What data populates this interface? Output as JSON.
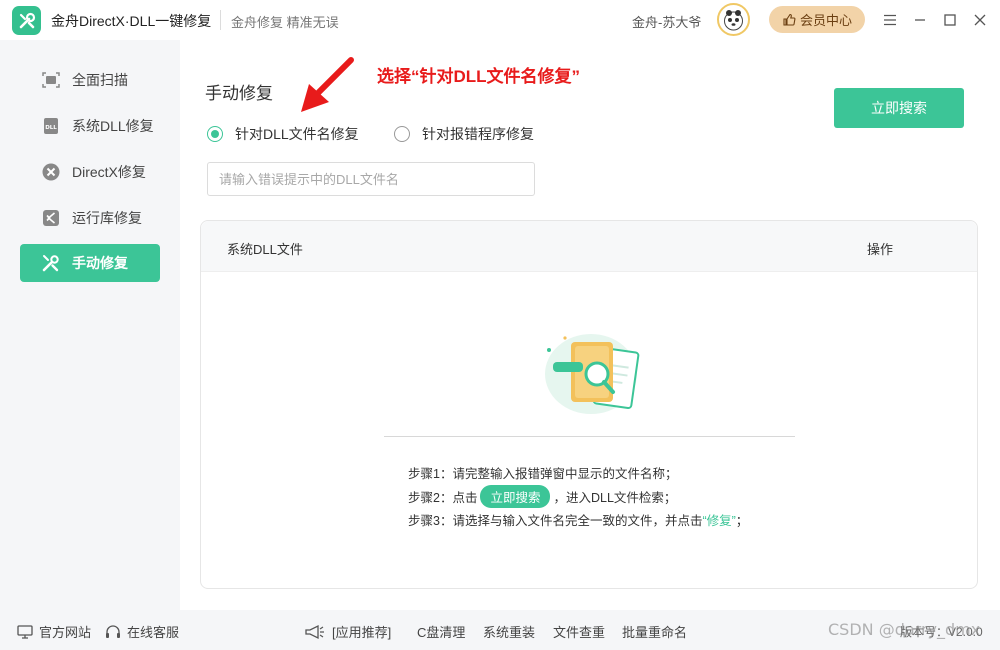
{
  "titlebar": {
    "app_title": "金舟DirectX·DLL一键修复",
    "subtitle": "金舟修复 精准无误",
    "username": "金舟-苏大爷",
    "vip_label": "会员中心"
  },
  "sidebar": {
    "items": [
      {
        "label": "全面扫描",
        "icon": "scan-icon",
        "active": false
      },
      {
        "label": "系统DLL修复",
        "icon": "dll-icon",
        "active": false
      },
      {
        "label": "DirectX修复",
        "icon": "directx-icon",
        "active": false
      },
      {
        "label": "运行库修复",
        "icon": "runtime-icon",
        "active": false
      },
      {
        "label": "手动修复",
        "icon": "tools-icon",
        "active": true
      }
    ]
  },
  "main": {
    "title": "手动修复",
    "annotation": "选择“针对DLL文件名修复”",
    "radio_options": [
      {
        "label": "针对DLL文件名修复",
        "checked": true
      },
      {
        "label": "针对报错程序修复",
        "checked": false
      }
    ],
    "search_button": "立即搜索",
    "input_placeholder": "请输入错误提示中的DLL文件名",
    "input_value": "",
    "table": {
      "col_file": "系统DLL文件",
      "col_op": "操作"
    },
    "steps": {
      "step1": "步骤1：请完整输入报错弹窗中显示的文件名称；",
      "step2_prefix": "步骤2：点击",
      "step2_button": "立即搜索",
      "step2_suffix": "，进入DLL文件检索；",
      "step3_prefix": "步骤3：请选择与输入文件名完全一致的文件，并点击",
      "step3_link": "“修复”",
      "step3_suffix": "；"
    }
  },
  "footer": {
    "website": "官方网站",
    "support": "在线客服",
    "recommend": "[应用推荐]",
    "links": [
      "C盘清理",
      "系统重装",
      "文件查重",
      "批量重命名"
    ],
    "version": "版本号：V2.0.0"
  },
  "watermark": "CSDN @darry_dmx",
  "colors": {
    "accent": "#3cc597",
    "annotation": "#e81b1b",
    "vip_bg": "#f2d3a8"
  }
}
